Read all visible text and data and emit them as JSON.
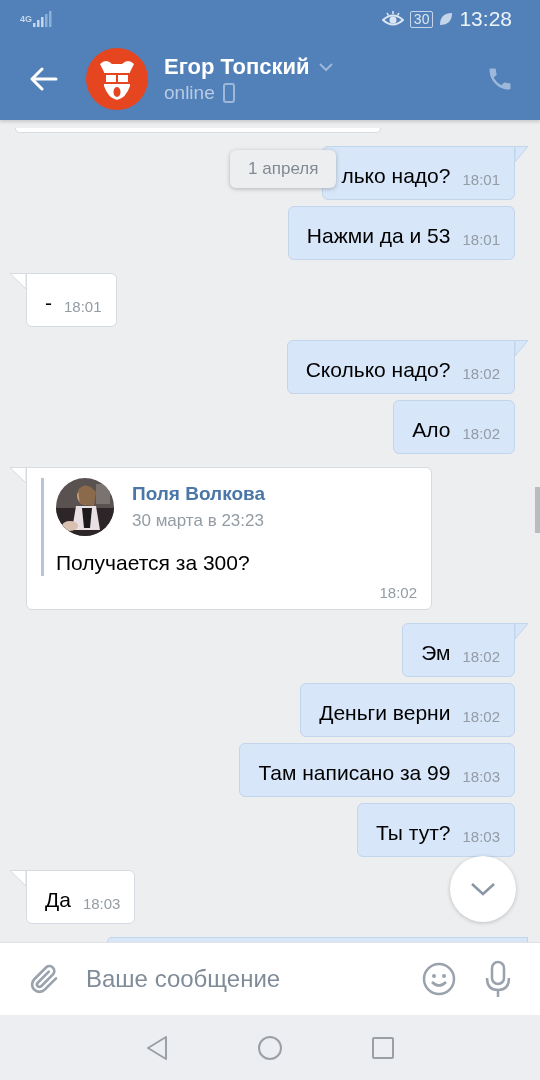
{
  "status_bar": {
    "network": "4G",
    "battery": "30",
    "time": "13:28"
  },
  "header": {
    "name": "Егор Топский",
    "status": "online"
  },
  "date_badge": "1 апреля",
  "messages": [
    {
      "kind": "partial",
      "outgoing": false
    },
    {
      "kind": "text",
      "outgoing": true,
      "text": "лько надо?",
      "time": "18:01",
      "covered": true
    },
    {
      "kind": "text",
      "outgoing": true,
      "text": "Нажми да и 53",
      "time": "18:01"
    },
    {
      "kind": "text",
      "outgoing": false,
      "text": "-",
      "time": "18:01"
    },
    {
      "kind": "text",
      "outgoing": true,
      "text": "Сколько надо?",
      "time": "18:02"
    },
    {
      "kind": "text",
      "outgoing": true,
      "text": "Ало",
      "time": "18:02"
    },
    {
      "kind": "forward",
      "outgoing": false,
      "author": "Поля Волкова",
      "date": "30 марта в 23:23",
      "text": "Получается за 300?",
      "time": "18:02"
    },
    {
      "kind": "text",
      "outgoing": true,
      "text": "Эм",
      "time": "18:02"
    },
    {
      "kind": "text",
      "outgoing": true,
      "text": "Деньги верни",
      "time": "18:02"
    },
    {
      "kind": "text",
      "outgoing": true,
      "text": "Там написано за 99",
      "time": "18:03"
    },
    {
      "kind": "text",
      "outgoing": true,
      "text": "Ты тут?",
      "time": "18:03"
    },
    {
      "kind": "text",
      "outgoing": false,
      "text": "Да",
      "time": "18:03"
    },
    {
      "kind": "partial",
      "outgoing": true
    }
  ],
  "composer": {
    "placeholder": "Ваше сообщение"
  }
}
